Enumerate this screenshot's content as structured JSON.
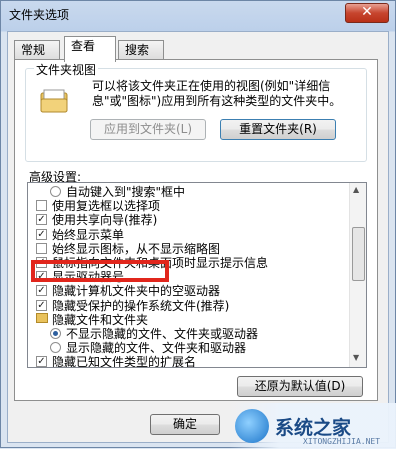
{
  "window": {
    "title": "文件夹选项",
    "close_glyph": "✕"
  },
  "tabs": [
    {
      "label": "常规"
    },
    {
      "label": "查看"
    },
    {
      "label": "搜索"
    }
  ],
  "folder_views": {
    "group_label": "文件夹视图",
    "description": "可以将该文件夹正在使用的视图(例如\"详细信息\"或\"图标\")应用到所有这种类型的文件夹中。",
    "apply_button": "应用到文件夹(L)",
    "reset_button": "重置文件夹(R)",
    "icon": "folder-icon"
  },
  "advanced": {
    "label": "高级设置:",
    "items": [
      {
        "kind": "radio",
        "checked": false,
        "indent": 1,
        "label": "自动键入到\"搜索\"框中"
      },
      {
        "kind": "check",
        "checked": false,
        "indent": 0,
        "label": "使用复选框以选择项"
      },
      {
        "kind": "check",
        "checked": true,
        "indent": 0,
        "label": "使用共享向导(推荐)"
      },
      {
        "kind": "check",
        "checked": true,
        "indent": 0,
        "label": "始终显示菜单"
      },
      {
        "kind": "check",
        "checked": false,
        "indent": 0,
        "label": "始终显示图标，从不显示缩略图"
      },
      {
        "kind": "check",
        "checked": true,
        "indent": 0,
        "label": "鼠标指向文件夹和桌面项时显示提示信息"
      },
      {
        "kind": "check",
        "checked": true,
        "indent": 0,
        "label": "显示驱动器号"
      },
      {
        "kind": "check",
        "checked": true,
        "indent": 0,
        "label": "隐藏计算机文件夹中的空驱动器"
      },
      {
        "kind": "check",
        "checked": true,
        "indent": 0,
        "label": "隐藏受保护的操作系统文件(推荐)"
      },
      {
        "kind": "folder",
        "checked": false,
        "indent": 0,
        "label": "隐藏文件和文件夹"
      },
      {
        "kind": "radio",
        "checked": true,
        "indent": 1,
        "label": "不显示隐藏的文件、文件夹或驱动器"
      },
      {
        "kind": "radio",
        "checked": false,
        "indent": 1,
        "label": "显示隐藏的文件、文件夹和驱动器"
      },
      {
        "kind": "check",
        "checked": true,
        "indent": 0,
        "label": "隐藏已知文件类型的扩展名"
      }
    ],
    "restore_button": "还原为默认值(D)"
  },
  "buttons": {
    "ok": "确定"
  },
  "watermark": {
    "text": "系统之家",
    "sub": "XITONGZHIJIA.NET"
  }
}
